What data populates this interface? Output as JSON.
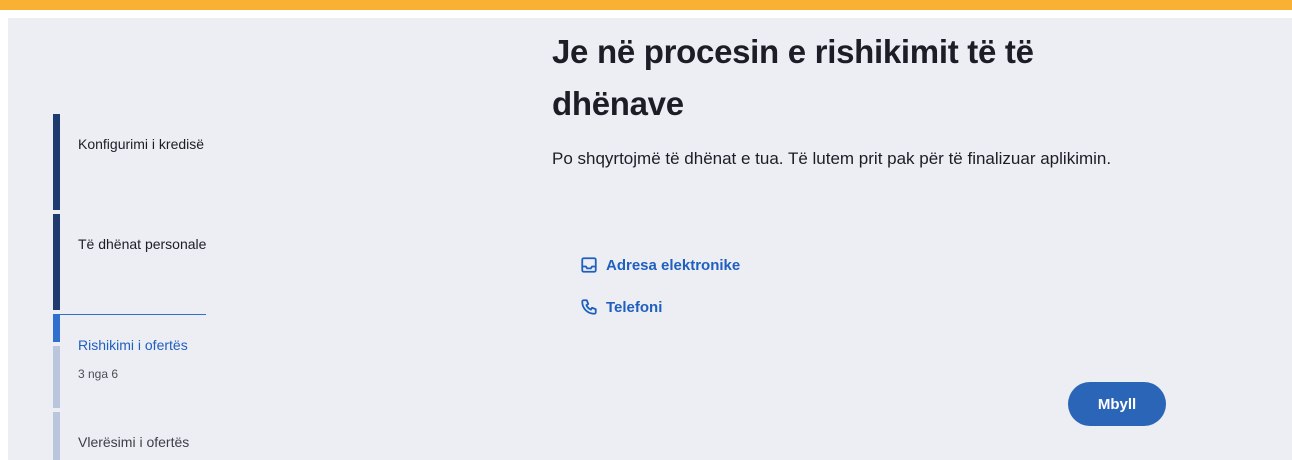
{
  "title": "Je në procesin e rishikimit të të dhënave",
  "subtitle": "Po shqyrtojmë të dhënat e tua. Të lutem prit pak për të finalizuar aplikimin.",
  "steps": [
    {
      "label": "Konfigurimi i kredisë",
      "state": "done"
    },
    {
      "label": "Të dhënat personale",
      "state": "done"
    },
    {
      "label": "Rishikimi i ofertës",
      "state": "active",
      "progress": "3 nga 6"
    },
    {
      "label": "Vlerësimi i ofertës",
      "state": "pending"
    }
  ],
  "contacts": {
    "email": {
      "label": "Adresa elektronike",
      "icon": "inbox-icon"
    },
    "phone": {
      "label": "Telefoni",
      "icon": "phone-icon"
    }
  },
  "close_button": {
    "label": "Mbyll"
  },
  "colors": {
    "accent_bar": "#f8b133",
    "primary": "#2a65b8",
    "link": "#1f5fbf",
    "step_done": "#1e3a6e"
  }
}
